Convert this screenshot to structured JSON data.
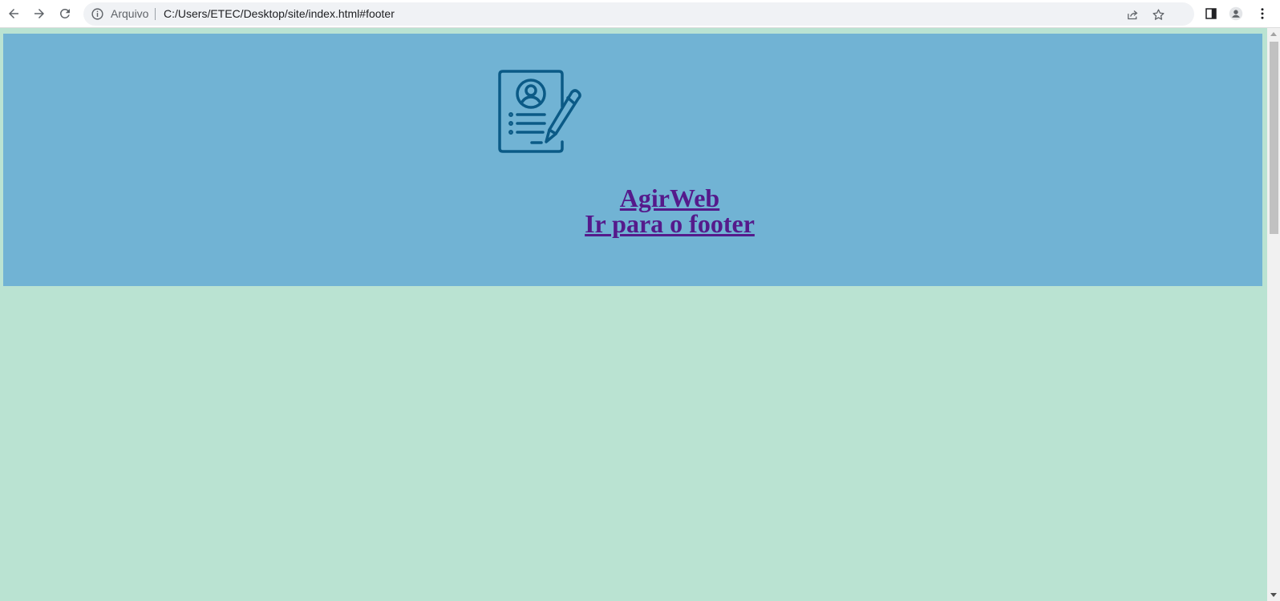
{
  "browser": {
    "back_icon": "arrow-left-icon",
    "forward_icon": "arrow-right-icon",
    "reload_icon": "reload-icon",
    "address_bar": {
      "scheme_label": "Arquivo",
      "url": "C:/Users/ETEC/Desktop/site/index.html#footer",
      "info_icon": "info-icon",
      "share_icon": "share-icon",
      "bookmark_icon": "star-icon"
    },
    "toolbar": {
      "side_panel_icon": "side-panel-icon",
      "profile_icon": "profile-icon",
      "menu_icon": "kebab-menu-icon"
    }
  },
  "page": {
    "header": {
      "logo_icon": "resume-pencil-icon",
      "title": "AgirWeb",
      "footer_link": "Ir para o footer"
    },
    "colors": {
      "background": "#bae3d2",
      "header_background": "#71b3d4",
      "link_color": "#551a8b",
      "logo_color": "#0b5a86"
    }
  }
}
